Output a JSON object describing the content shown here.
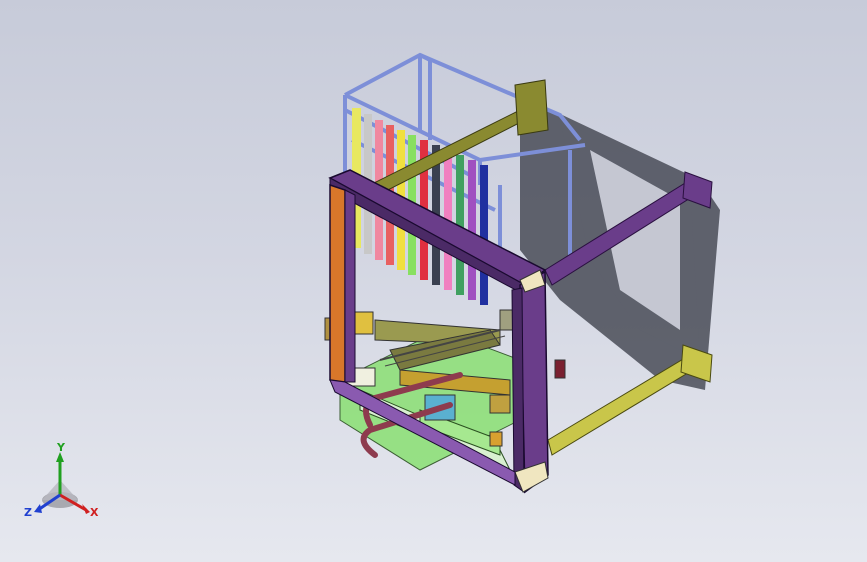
{
  "triad": {
    "x_label": "X",
    "y_label": "Y",
    "z_label": "Z"
  },
  "colors": {
    "background_top": "#c7cbd9",
    "background_bottom": "#e6e8ef",
    "frame_purple": "#6a3d8a",
    "frame_orange": "#d9772a",
    "cage_blue": "#7d8fd8",
    "beam_olive": "#8a8a30",
    "beam_yellow": "#c9c64a",
    "base_green": "#8fe07a",
    "hook_maroon": "#8e3b4e",
    "shadow": "#4a4d58",
    "axis_x": "#d02020",
    "axis_y": "#20a020",
    "axis_z": "#2040d0"
  },
  "icons": [
    "view-triad-icon"
  ]
}
